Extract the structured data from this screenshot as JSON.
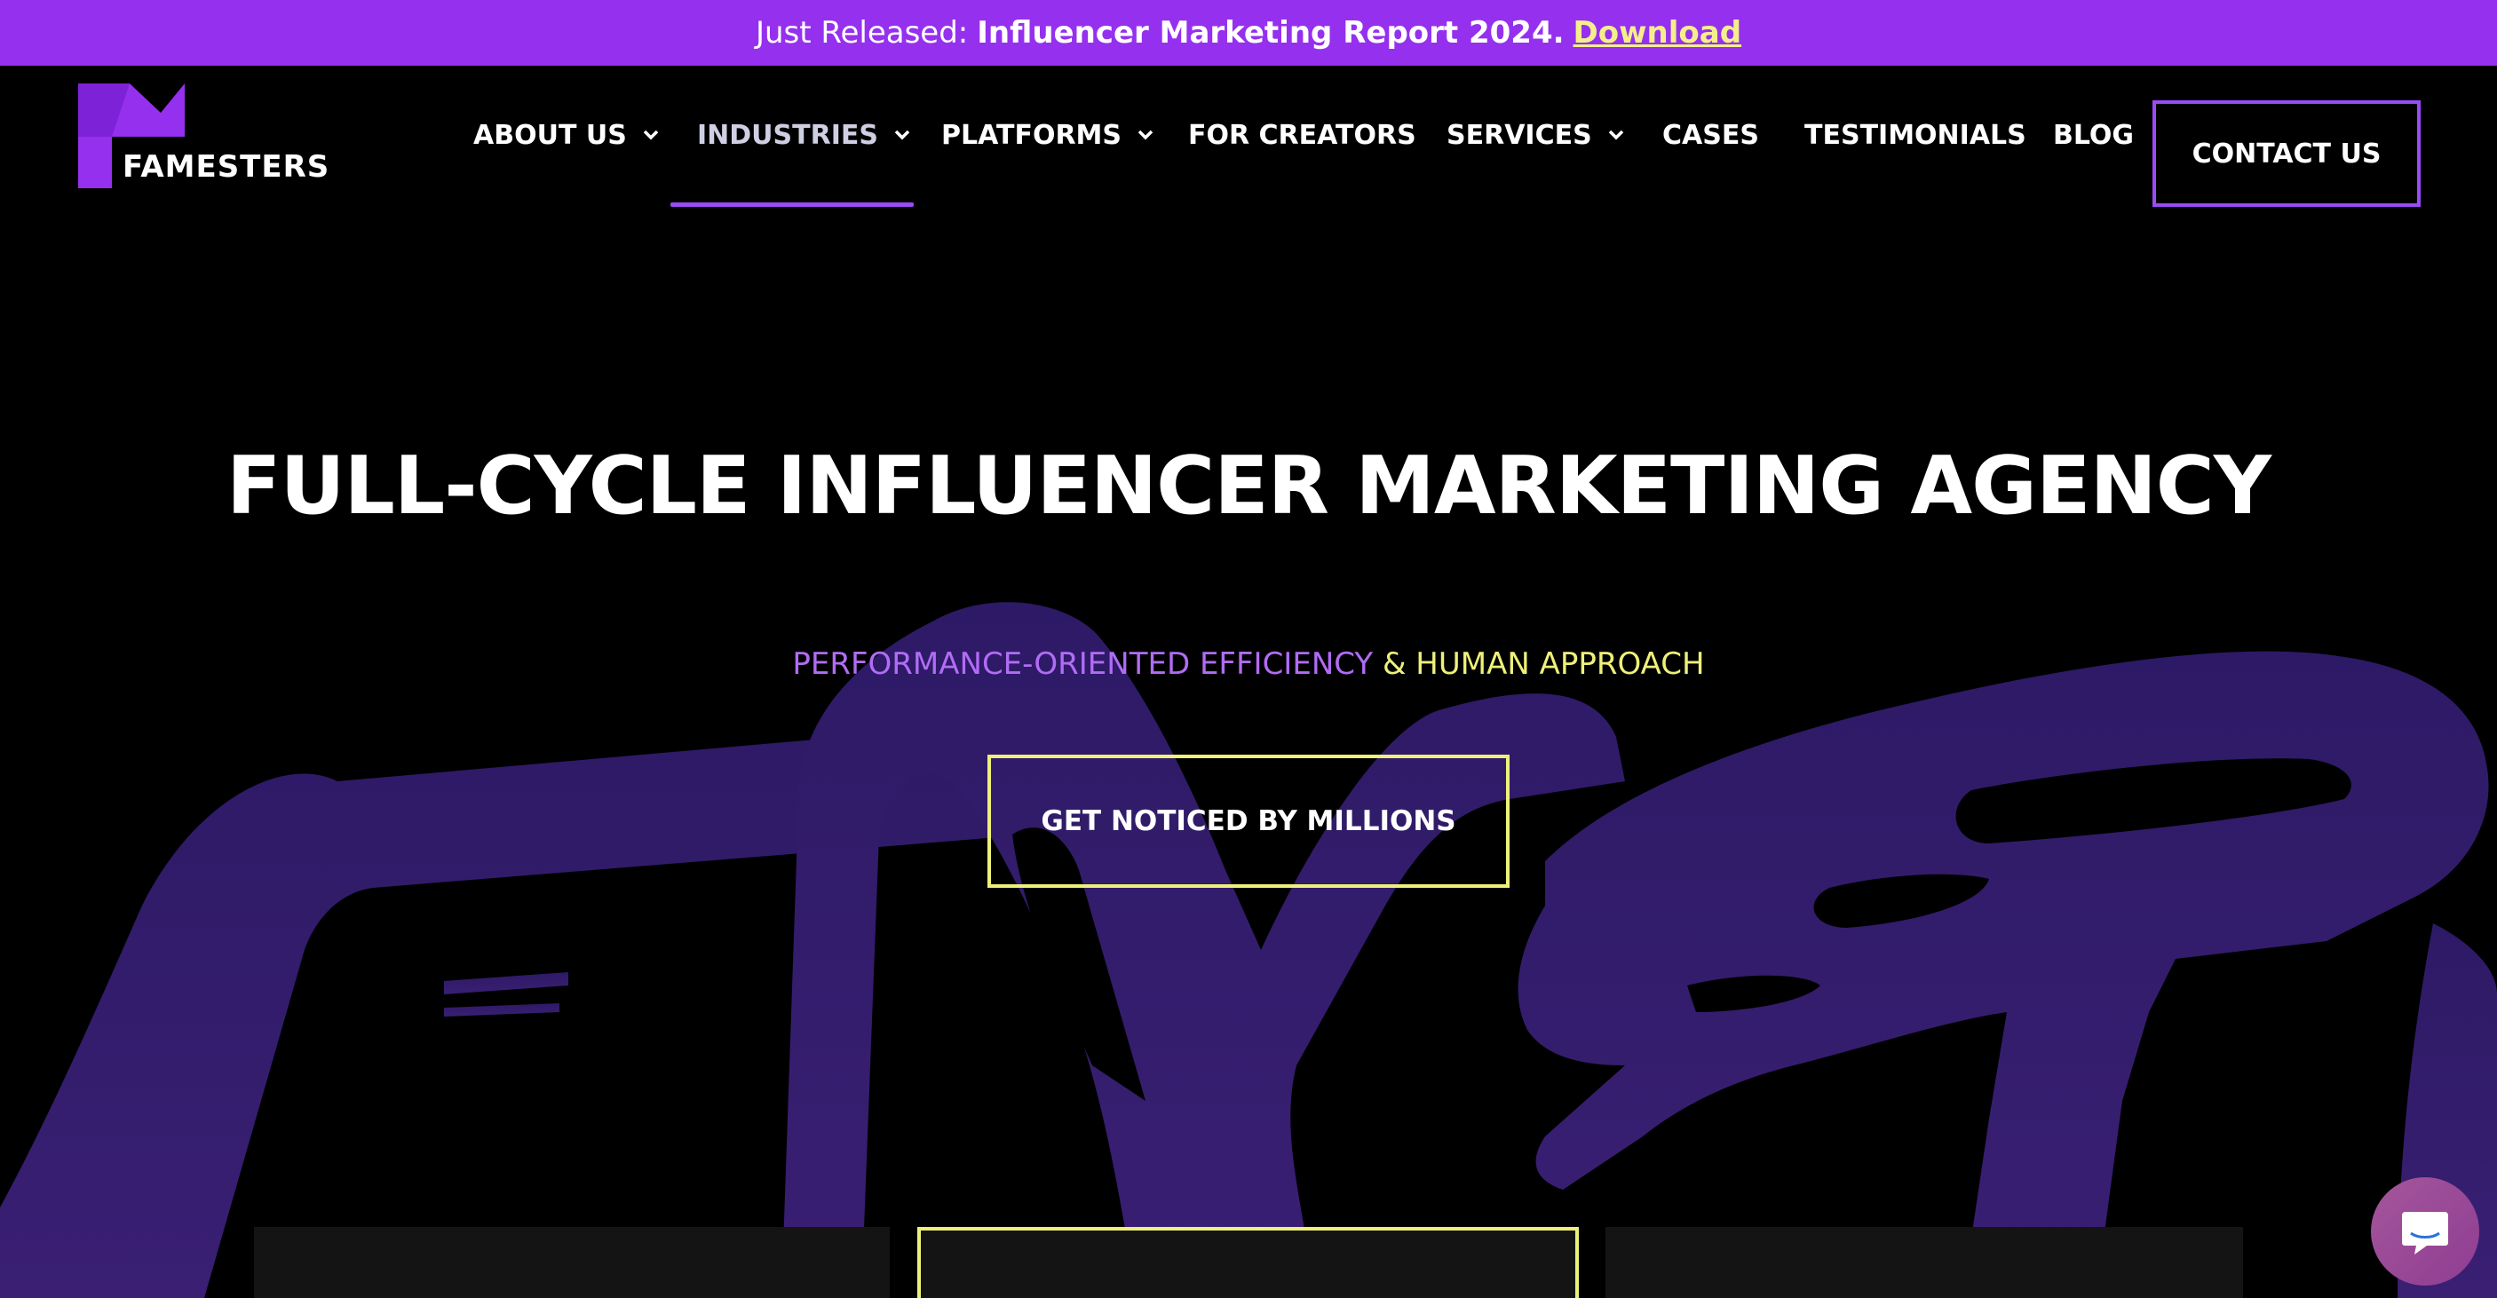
{
  "announcement": {
    "lead": "Just Released:",
    "report": "Influencer Marketing Report 2024.",
    "link": "Download"
  },
  "logo": {
    "text": "FAMESTERS"
  },
  "nav": {
    "items": [
      {
        "label": "ABOUT US"
      },
      {
        "label": "INDUSTRIES"
      },
      {
        "label": "PLATFORMS"
      },
      {
        "label": "FOR CREATORS"
      },
      {
        "label": "SERVICES"
      },
      {
        "label": "CASES"
      },
      {
        "label": "TESTIMONIALS"
      },
      {
        "label": "BLOG"
      }
    ],
    "contact": "CONTACT US",
    "active": "INDUSTRIES"
  },
  "hero": {
    "title": "FULL-CYCLE INFLUENCER MARKETING AGENCY",
    "subtitle_part1": "PERFORMANCE-ORIENTED EFFICIENCY",
    "subtitle_part2": "& HUMAN APPROACH",
    "cta": "GET NOTICED BY MILLIONS"
  },
  "colors": {
    "announcement_bg": "#9530ef",
    "accent_purple": "#9a4bf5",
    "accent_yellow": "#eef07a",
    "background": "#000000",
    "brush": "#2e1a63"
  },
  "icons": {
    "chevron": "chevron-down-icon",
    "chat": "chat-bubble-icon",
    "logo": "famesters-logo-mark"
  }
}
